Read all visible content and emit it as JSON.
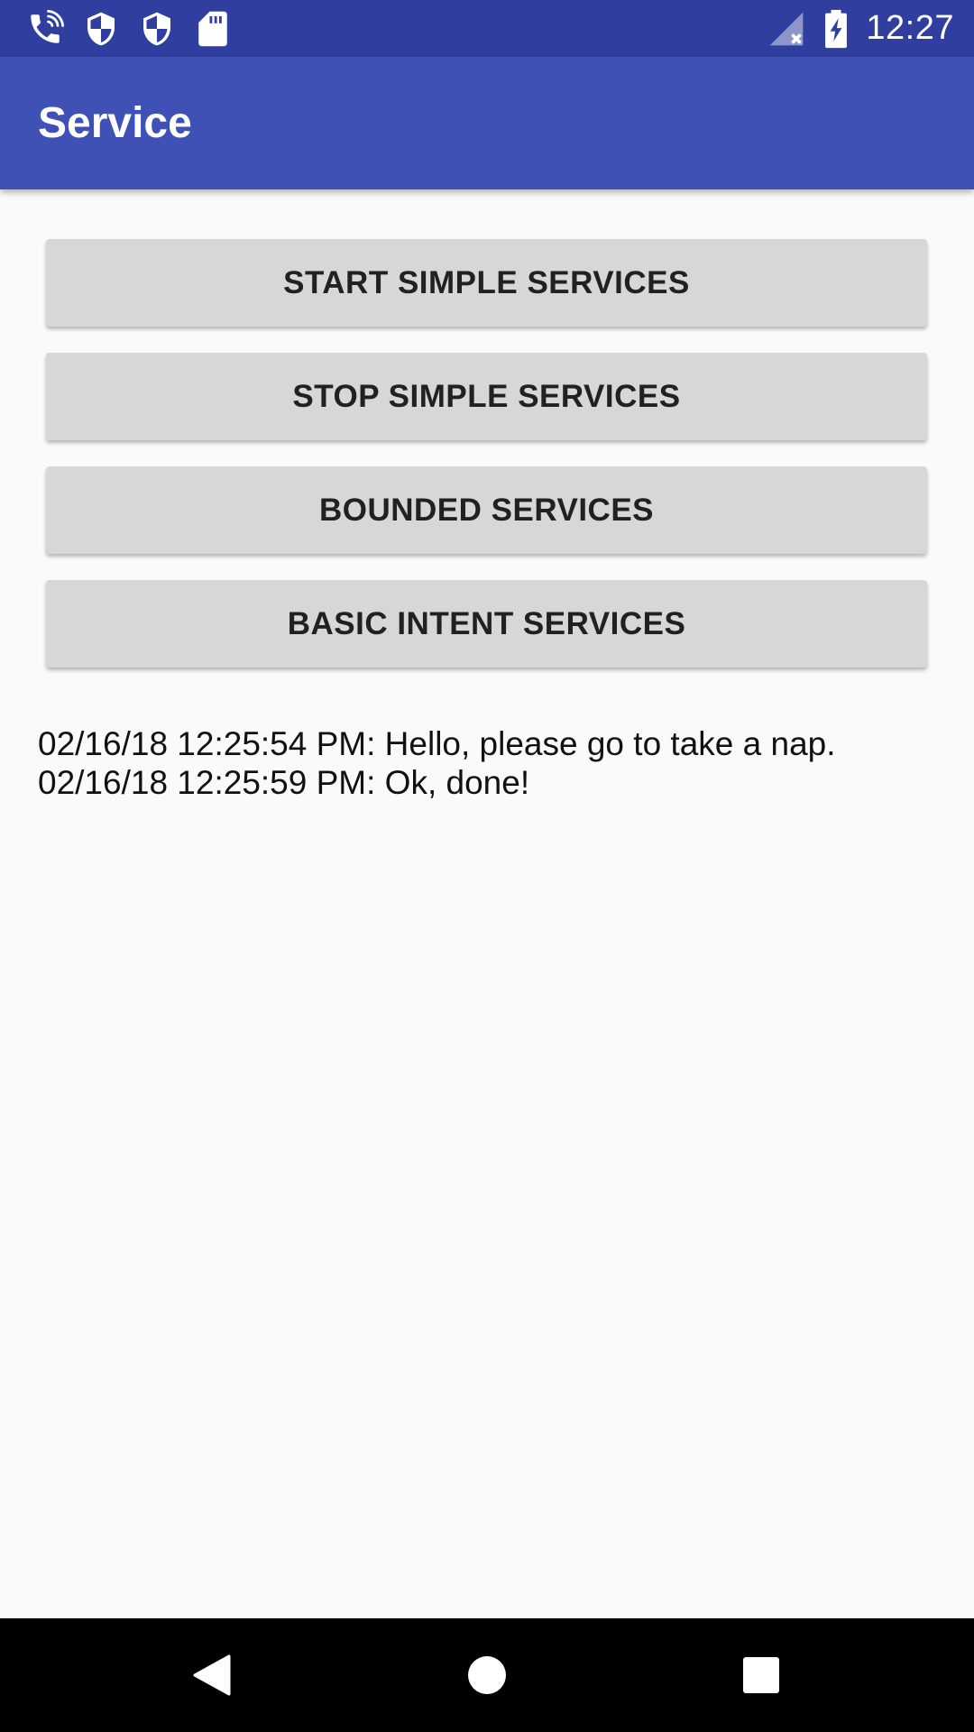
{
  "status_bar": {
    "time": "12:27",
    "icons": [
      "wifi-calling-icon",
      "shield-icon",
      "shield-icon",
      "sd-card-icon",
      "no-signal-icon",
      "battery-charging-icon"
    ]
  },
  "app_bar": {
    "title": "Service"
  },
  "buttons": {
    "start_simple": "START SIMPLE SERVICES",
    "stop_simple": "STOP SIMPLE SERVICES",
    "bounded": "BOUNDED SERVICES",
    "basic_intent": "BASIC INTENT SERVICES"
  },
  "log": {
    "lines": [
      "02/16/18 12:25:54 PM: Hello, please go to take a nap.",
      "02/16/18 12:25:59 PM: Ok, done!"
    ]
  },
  "nav_bar": {
    "icons": [
      "back-icon",
      "home-icon",
      "recents-icon"
    ]
  },
  "colors": {
    "status_bar": "#303f9f",
    "app_bar": "#3f51b5",
    "background": "#fafafa",
    "button": "#d6d7d7"
  }
}
